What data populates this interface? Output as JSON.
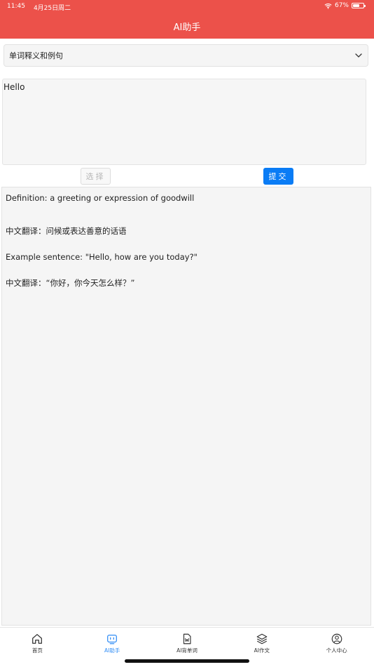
{
  "status_bar": {
    "time": "11:45",
    "date": "4月25日周二",
    "battery": "67%",
    "battery_level": 0.67,
    "wifi_icon": "wifi-icon"
  },
  "header": {
    "title": "AI助手"
  },
  "selector": {
    "value": "单词释义和例句",
    "icon": "chevron-down-icon"
  },
  "input": {
    "value": "Hello"
  },
  "buttons": {
    "select_label": "选择",
    "submit_label": "提交"
  },
  "output": {
    "lines": [
      "Definition: a greeting or expression of goodwill",
      "中文翻译：问候或表达善意的话语",
      "Example sentence: \"Hello, how are you today?\"",
      "中文翻译：“你好，你今天怎么样？”"
    ]
  },
  "tabs": [
    {
      "label": "首页",
      "icon": "home-icon",
      "active": false
    },
    {
      "label": "AI助手",
      "icon": "robot-icon",
      "active": true
    },
    {
      "label": "AI背单词",
      "icon": "word-document-icon",
      "active": false
    },
    {
      "label": "AI作文",
      "icon": "layers-icon",
      "active": false
    },
    {
      "label": "个人中心",
      "icon": "user-icon",
      "active": false
    }
  ],
  "colors": {
    "header": "#ec514a",
    "accent": "#0a7cf5",
    "tab_active": "#2f8cf5"
  }
}
